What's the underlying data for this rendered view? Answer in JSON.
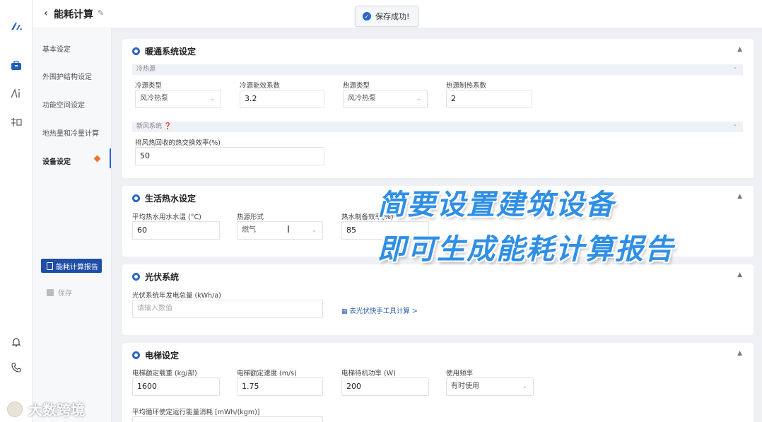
{
  "app": {
    "title": "能耗计算"
  },
  "toast": {
    "text": "保存成功!"
  },
  "rail_icons": [
    "logo-icon",
    "briefcase-icon",
    "ai-icon",
    "knowledge-icon",
    "bell-icon",
    "phone-icon"
  ],
  "nav": {
    "items": [
      "基本设定",
      "外围护结构设定",
      "功能空间设定",
      "地热量和冷量计算",
      "设备设定"
    ],
    "active": "设备设定",
    "report_button": "能耗计算报告",
    "save_button": "保存"
  },
  "hvac": {
    "title": "暖通系统设定",
    "cold_source_header": "冷热源",
    "fields": [
      {
        "label": "冷源类型",
        "value": "风冷热泵",
        "type": "select"
      },
      {
        "label": "冷源能效系数",
        "value": "3.2",
        "type": "input"
      },
      {
        "label": "热源类型",
        "value": "风冷热泵",
        "type": "select"
      },
      {
        "label": "热源制热系数",
        "value": "2",
        "type": "input"
      }
    ],
    "fresh_air_header": "新风系统",
    "fresh_air_field": {
      "label": "排风热回收的热交换效率(%)",
      "value": "50"
    }
  },
  "hot_water": {
    "title": "生活热水设定",
    "fields": [
      {
        "label": "平均热水用水水温 (°C)",
        "value": "60",
        "type": "input"
      },
      {
        "label": "热源形式",
        "value": "燃气",
        "type": "select"
      },
      {
        "label": "热水制备效率(%)",
        "value": "85",
        "type": "input"
      }
    ]
  },
  "pv": {
    "title": "光伏系统",
    "field_label": "光伏系统年发电总量 (kWh/a)",
    "placeholder": "请输入数值",
    "link": "去光伏快手工具计算 >"
  },
  "elevator": {
    "title": "电梯设定",
    "fields": [
      {
        "label": "电梯额定载重 (kg/部)",
        "value": "1600",
        "type": "input"
      },
      {
        "label": "电梯额定速度 (m/s)",
        "value": "1.75",
        "type": "input"
      },
      {
        "label": "电梯待机功率 (W)",
        "value": "200",
        "type": "input"
      },
      {
        "label": "使用频率",
        "value": "有时使用",
        "type": "select"
      }
    ],
    "bottom_label": "平均循环使定运行能量消耗 [mWh/(kgm)]"
  },
  "overlay": {
    "line1": "简要设置建筑设备",
    "line2": "即可生成能耗计算报告",
    "color": "#2f8fe6"
  },
  "watermark": {
    "text": "大数跨境"
  },
  "colors": {
    "accent": "#2b66c9",
    "button": "#1f4ea8",
    "badge": "#e8762c"
  }
}
